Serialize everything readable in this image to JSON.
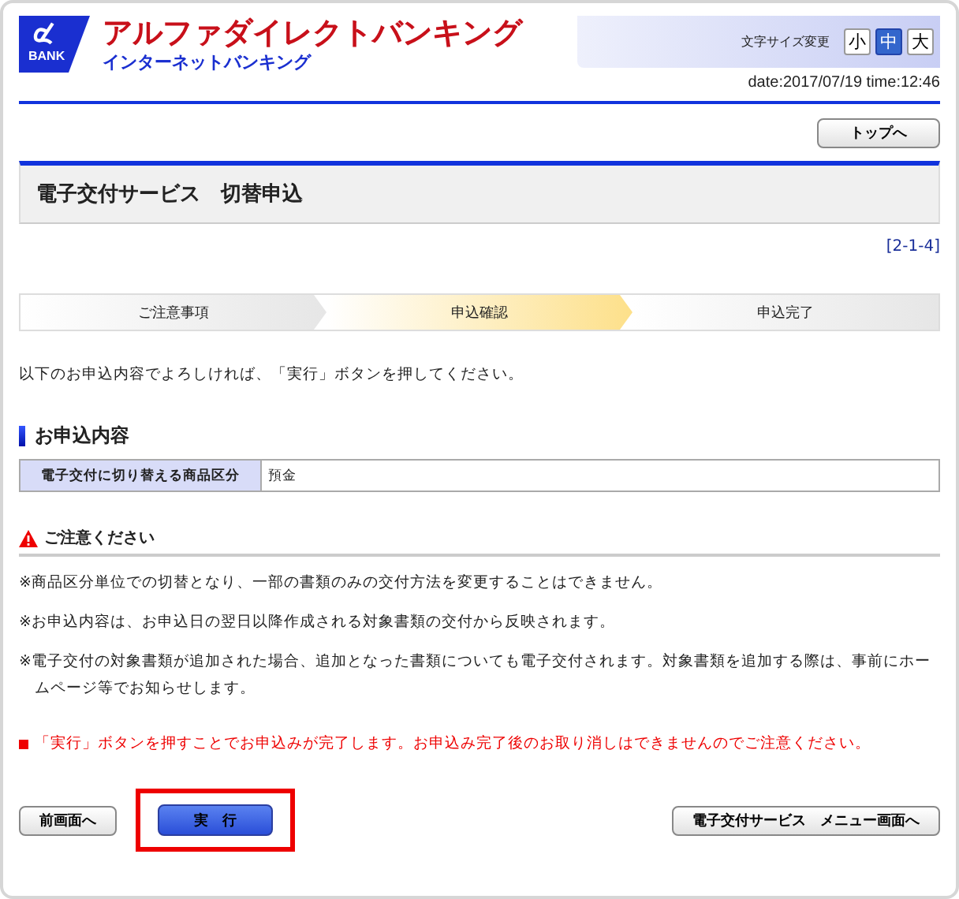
{
  "header": {
    "logo_text": "BANK",
    "title": "アルファダイレクトバンキング",
    "subtitle": "インターネットバンキング",
    "font_size_label": "文字サイズ変更",
    "font_sizes": [
      {
        "label": "小",
        "selected": false
      },
      {
        "label": "中",
        "selected": true
      },
      {
        "label": "大",
        "selected": false
      }
    ],
    "datetime": "date:2017/07/19 time:12:46"
  },
  "top_button": "トップへ",
  "page_title": "電子交付サービス　切替申込",
  "screen_id": "[2-1-4]",
  "steps": [
    {
      "label": "ご注意事項",
      "selected": false
    },
    {
      "label": "申込確認",
      "selected": true
    },
    {
      "label": "申込完了",
      "selected": false
    }
  ],
  "instruction": "以下のお申込内容でよろしければ、「実行」ボタンを押してください。",
  "section_title": "お申込内容",
  "table": {
    "rows": [
      {
        "label": "電子交付に切り替える商品区分",
        "value": "預金"
      }
    ]
  },
  "caution": {
    "title": "ご注意ください",
    "notes": [
      "※商品区分単位での切替となり、一部の書類のみの交付方法を変更することはできません。",
      "※お申込内容は、お申込日の翌日以降作成される対象書類の交付から反映されます。",
      "※電子交付の対象書類が追加された場合、追加となった書類についても電子交付されます。対象書類を追加する際は、事前にホームページ等でお知らせします。"
    ]
  },
  "warning": "「実行」ボタンを押すことでお申込みが完了します。お申込み完了後のお取り消しはできませんのでご注意ください。",
  "buttons": {
    "back": "前画面へ",
    "execute": {
      "label": "実　行",
      "highlighted": true
    },
    "menu": "電子交付サービス　メニュー画面へ"
  }
}
